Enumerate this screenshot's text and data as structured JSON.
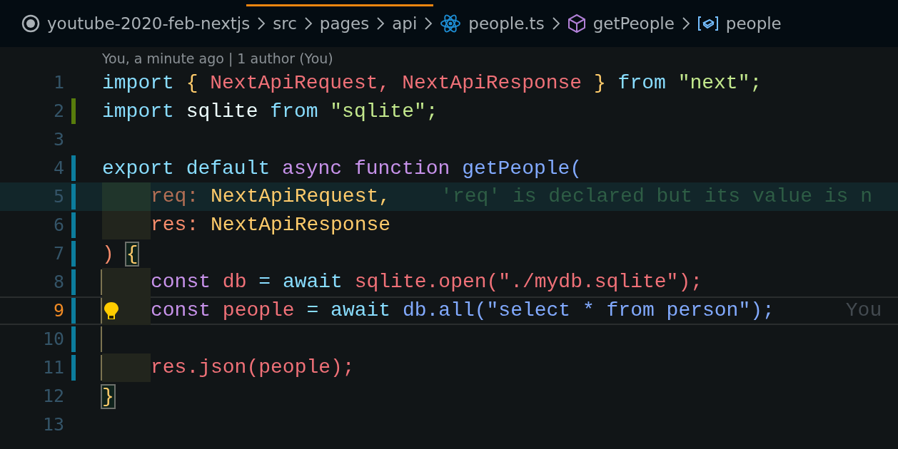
{
  "breadcrumbs": [
    {
      "kind": "root",
      "label": "youtube-2020-feb-nextjs"
    },
    {
      "kind": "folder",
      "label": "src"
    },
    {
      "kind": "folder",
      "label": "pages"
    },
    {
      "kind": "folder",
      "label": "api"
    },
    {
      "kind": "file",
      "label": "people.ts"
    },
    {
      "kind": "function",
      "label": "getPeople"
    },
    {
      "kind": "variable",
      "label": "people"
    }
  ],
  "blame_header": "You, a minute ago | 1 author (You)",
  "lines": [
    {
      "number": "1",
      "kind": "unchanged",
      "current": false,
      "scope": false,
      "tokens": [
        {
          "kind": "keyword",
          "text": "import"
        },
        {
          "kind": "brace",
          "text": "{"
        },
        {
          "kind": "var",
          "text": "NextApiRequest,"
        },
        {
          "kind": "var",
          "text": "NextApiResponse"
        },
        {
          "kind": "brace",
          "text": "}"
        },
        {
          "kind": "keyword",
          "text": "from"
        },
        {
          "kind": "string",
          "text": "\"next\";"
        }
      ]
    },
    {
      "number": "2",
      "kind": "added",
      "current": false,
      "scope": false,
      "tokens": [
        {
          "kind": "keyword",
          "text": "import"
        },
        {
          "kind": "plain",
          "text": "sqlite"
        },
        {
          "kind": "keyword",
          "text": "from"
        },
        {
          "kind": "string",
          "text": "\"sqlite\";"
        }
      ]
    },
    {
      "number": "3",
      "kind": "unchanged",
      "current": false,
      "scope": false
    },
    {
      "number": "4",
      "kind": "modified",
      "current": false,
      "scope": false,
      "tokens": [
        {
          "kind": "keyword",
          "text": "export"
        },
        {
          "kind": "keyword",
          "text": "default"
        },
        {
          "kind": "storage",
          "text": "async"
        },
        {
          "kind": "storage",
          "text": "function"
        },
        {
          "kind": "func",
          "text": "getPeople("
        }
      ]
    },
    {
      "number": "5",
      "kind": "modified",
      "current": false,
      "scope": false,
      "diagnostic": {
        "hint": "'req' is declared but its value is n"
      },
      "tokens": [
        {
          "kind": "indent"
        },
        {
          "kind": "unused",
          "text": "req:"
        },
        {
          "kind": "type",
          "text": "NextApiRequest,"
        }
      ]
    },
    {
      "number": "6",
      "kind": "modified",
      "current": false,
      "scope": false,
      "tokens": [
        {
          "kind": "indent"
        },
        {
          "kind": "param",
          "text": "res:"
        },
        {
          "kind": "type",
          "text": "NextApiResponse"
        }
      ]
    },
    {
      "number": "7",
      "kind": "modified",
      "current": false,
      "scope": false,
      "tokens": [
        {
          "kind": "param",
          "text": ")"
        },
        {
          "kind": "matched",
          "text": "{"
        }
      ]
    },
    {
      "number": "8",
      "kind": "modified",
      "current": false,
      "scope": true,
      "tokens": [
        {
          "kind": "indent"
        },
        {
          "kind": "storage",
          "text": "const"
        },
        {
          "kind": "var",
          "text": "db"
        },
        {
          "kind": "keyword",
          "text": "="
        },
        {
          "kind": "keyword",
          "text": "await"
        },
        {
          "kind": "var",
          "text": "sqlite.open(\"./mydb.sqlite\");"
        }
      ]
    },
    {
      "number": "9",
      "kind": "modified",
      "current": true,
      "scope": true,
      "gutter_icon": {
        "kind": "lightbulb"
      },
      "blame": "You",
      "tokens": [
        {
          "kind": "indent"
        },
        {
          "kind": "storage",
          "text": "const"
        },
        {
          "kind": "var",
          "text": "people"
        },
        {
          "kind": "keyword",
          "text": "="
        },
        {
          "kind": "keyword",
          "text": "await"
        },
        {
          "kind": "func",
          "text": "db.all(\"select * from person\");"
        }
      ]
    },
    {
      "number": "10",
      "kind": "modified",
      "current": false,
      "scope": true
    },
    {
      "number": "11",
      "kind": "modified",
      "current": false,
      "scope": true,
      "tokens": [
        {
          "kind": "indent"
        },
        {
          "kind": "var",
          "text": "res.json(people);"
        }
      ]
    },
    {
      "number": "12",
      "kind": "unchanged",
      "current": false,
      "scope": false,
      "tokens": [
        {
          "kind": "matched",
          "text": "}"
        }
      ]
    },
    {
      "number": "13",
      "kind": "unchanged",
      "current": false,
      "scope": false
    }
  ]
}
